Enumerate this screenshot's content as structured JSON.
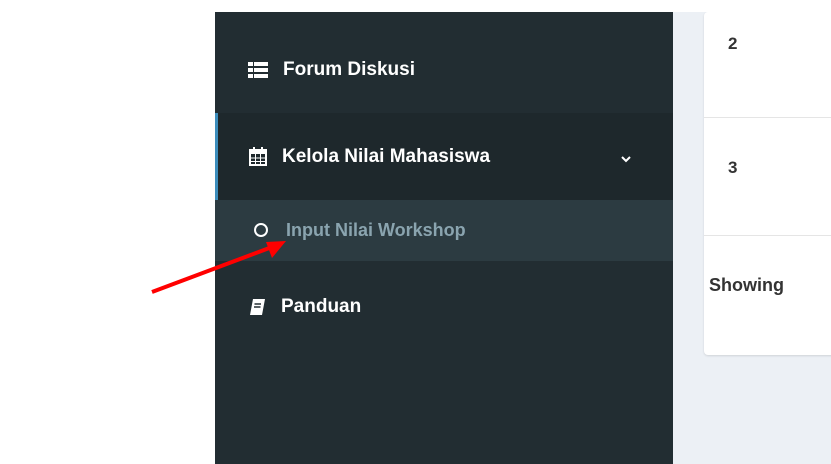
{
  "sidebar": {
    "items": [
      {
        "label": "Forum Diskusi",
        "icon": "list-icon"
      },
      {
        "label": "Kelola Nilai Mahasiswa",
        "icon": "calendar-icon",
        "expanded": true
      },
      {
        "label": "Input Nilai Workshop",
        "icon": "circle-icon"
      },
      {
        "label": "Panduan",
        "icon": "book-icon"
      }
    ]
  },
  "table": {
    "rows": [
      {
        "number": "2"
      },
      {
        "number": "3"
      }
    ],
    "showing_text": "Showing"
  },
  "annotation": {
    "color": "#ff0000",
    "points_to": "Input Nilai Workshop"
  },
  "colors": {
    "sidebar_bg": "#222d32",
    "active_bg": "#1e282c",
    "submenu_bg": "#2c3b41",
    "accent": "#3c8dbc",
    "content_bg": "#ecf0f5"
  }
}
